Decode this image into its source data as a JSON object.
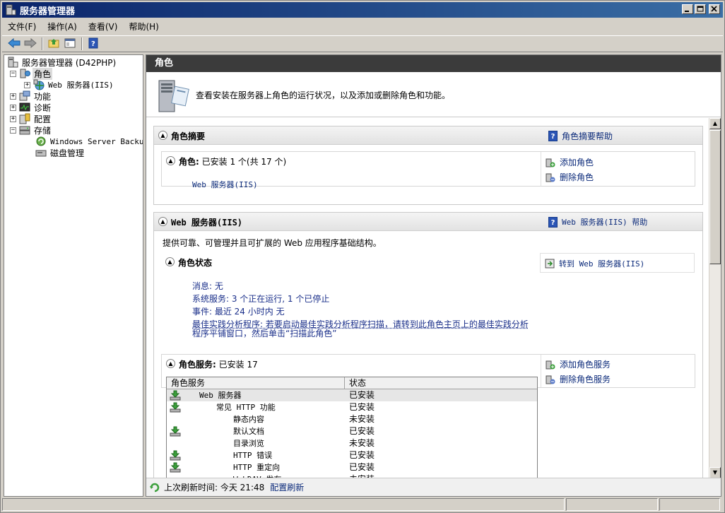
{
  "window": {
    "title": "服务器管理器"
  },
  "menu": [
    {
      "label": "文件(F)"
    },
    {
      "label": "操作(A)"
    },
    {
      "label": "查看(V)"
    },
    {
      "label": "帮助(H)"
    }
  ],
  "tree": {
    "root": "服务器管理器 (D42PHP)",
    "roles": "角色",
    "web_server": "Web 服务器(IIS)",
    "features": "功能",
    "diagnostics": "诊断",
    "configuration": "配置",
    "storage": "存储",
    "backup": "Windows Server Backup",
    "disk_mgmt": "磁盘管理"
  },
  "content": {
    "header": "角色",
    "intro": "查看安装在服务器上角色的运行状况，以及添加或删除角色和功能。"
  },
  "summary": {
    "title": "角色摘要",
    "help": "角色摘要帮助",
    "roles_line": "角色: 已安装 1 个(共 17 个)",
    "roles_line_bold": "角色:",
    "roles_line_rest": "已安装 1 个(共 17 个)",
    "installed_role": "Web 服务器(IIS)",
    "add_role": "添加角色",
    "remove_role": "删除角色"
  },
  "web": {
    "title": "Web 服务器(IIS)",
    "help": "Web 服务器(IIS) 帮助",
    "description": "提供可靠、可管理并且可扩展的 Web 应用程序基础结构。",
    "status_title": "角色状态",
    "goto": "转到 Web 服务器(IIS)",
    "messages": "消息: 无",
    "services": "系统服务: 3 个正在运行, 1 个已停止",
    "events": "事件: 最近 24 小时内 无",
    "bpa_line1": "最佳实践分析程序: 若要启动最佳实践分析程序扫描，请转到此角色主页上的最佳实践分析",
    "bpa_line2": "程序平铺窗口，然后单击“扫描此角色”",
    "services_title": "角色服务:",
    "services_count": "已安装 17",
    "add_service": "添加角色服务",
    "remove_service": "删除角色服务"
  },
  "grid": {
    "col_name": "角色服务",
    "col_state": "状态",
    "rows": [
      {
        "name": "Web 服务器",
        "state": "已安装",
        "indent": 1,
        "installed": true
      },
      {
        "name": "常见 HTTP 功能",
        "state": "已安装",
        "indent": 2,
        "installed": true
      },
      {
        "name": "静态内容",
        "state": "未安装",
        "indent": 3,
        "installed": false
      },
      {
        "name": "默认文档",
        "state": "已安装",
        "indent": 3,
        "installed": true
      },
      {
        "name": "目录浏览",
        "state": "未安装",
        "indent": 3,
        "installed": false
      },
      {
        "name": "HTTP 错误",
        "state": "已安装",
        "indent": 3,
        "installed": true
      },
      {
        "name": "HTTP 重定向",
        "state": "已安装",
        "indent": 3,
        "installed": true
      },
      {
        "name": "WebDAV 发布",
        "state": "未安装",
        "indent": 3,
        "installed": false
      }
    ]
  },
  "refresh": {
    "label": "上次刷新时间: 今天 21:48",
    "link": "配置刷新"
  },
  "colors": {
    "title_start": "#0a246a",
    "title_end": "#3a6ea5",
    "header_bg": "#3b3b3b",
    "link": "#0b2a7a"
  }
}
